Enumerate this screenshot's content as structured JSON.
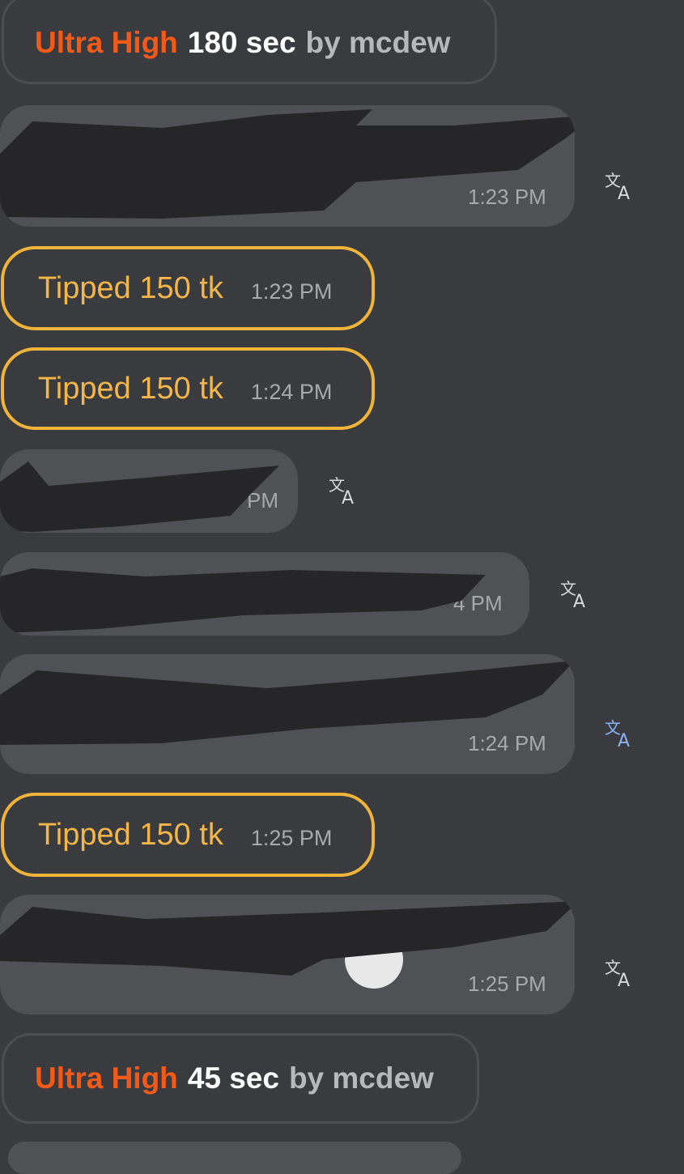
{
  "system_messages": [
    {
      "level": "Ultra High",
      "duration": "180 sec",
      "by": "by mcdew"
    },
    {
      "level": "Ultra High",
      "duration": "45 sec",
      "by": "by mcdew"
    }
  ],
  "messages": [
    {
      "time": "1:23 PM"
    },
    {
      "time": "PM"
    },
    {
      "time": "4 PM"
    },
    {
      "time": "1:24 PM"
    },
    {
      "time": "1:25 PM"
    }
  ],
  "tips": [
    {
      "label": "Tipped 150 tk",
      "time": "1:23 PM"
    },
    {
      "label": "Tipped 150 tk",
      "time": "1:24 PM"
    },
    {
      "label": "Tipped 150 tk",
      "time": "1:25 PM"
    }
  ],
  "icons": {
    "translate": "translate-icon"
  },
  "colors": {
    "background": "#3a3b3f",
    "bubble": "#505154",
    "level": "#f25a1a",
    "tip_border": "#f0b43a",
    "translate_default": "#d8d9dc",
    "translate_active": "#8ab4f8",
    "redaction": "#262628"
  }
}
